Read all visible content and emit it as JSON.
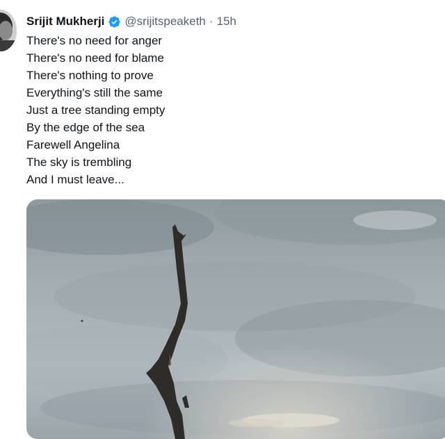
{
  "tweet": {
    "author": {
      "display_name": "Srijit Mukherji",
      "handle": "@srijitspeaketh",
      "verified_icon": "verified-badge-icon",
      "avatar_icon": "avatar"
    },
    "separator": "·",
    "timestamp": "15h",
    "lines": [
      "There's no need for anger",
      "There's no need for blame",
      "There's nothing to prove",
      "Everything's still the same",
      "Just a tree standing empty",
      "By the edge of the sea",
      "Farewell Angelina",
      "The sky is trembling",
      "And I must leave..."
    ],
    "colors": {
      "verified_blue": "#1d9bf0",
      "secondary_text": "#536471",
      "primary_text": "#0f1419"
    }
  }
}
